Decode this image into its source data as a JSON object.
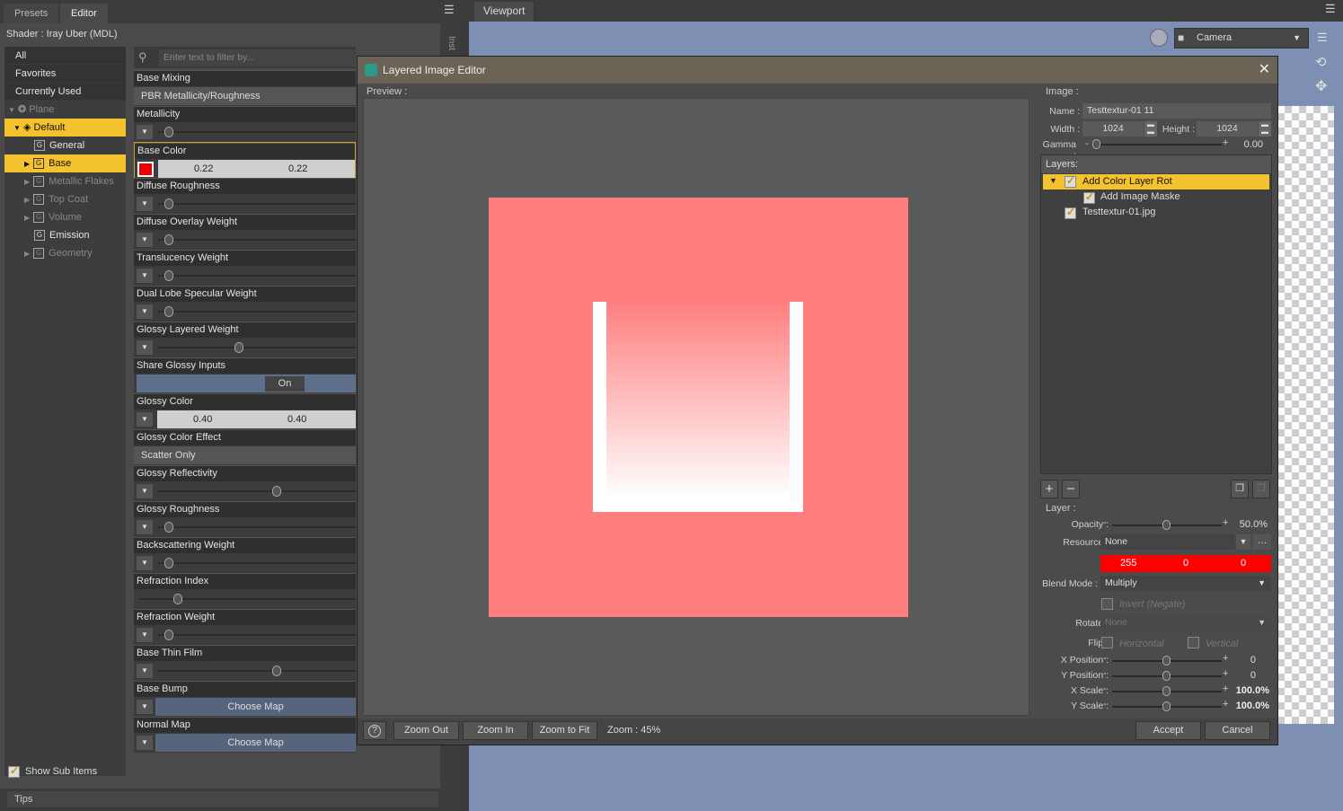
{
  "left_tabs": [
    "Presets",
    "Editor"
  ],
  "shader_label": "Shader :  Iray Uber (MDL)",
  "categories": [
    "All",
    "Favorites",
    "Currently Used"
  ],
  "tree": [
    {
      "label": "Plane"
    },
    {
      "label": "Default"
    },
    {
      "label": "General"
    },
    {
      "label": "Base"
    },
    {
      "label": "Metallic Flakes"
    },
    {
      "label": "Top Coat"
    },
    {
      "label": "Volume"
    },
    {
      "label": "Emission"
    },
    {
      "label": "Geometry"
    }
  ],
  "show_sub_items": "Show Sub Items",
  "filter_placeholder": "Enter text to filter by...",
  "properties": [
    {
      "label": "Base Mixing",
      "text": "PBR Metallicity/Roughness"
    },
    {
      "label": "Metallicity"
    },
    {
      "label": "Base Color",
      "v1": "0.22",
      "v2": "0.22"
    },
    {
      "label": "Diffuse Roughness"
    },
    {
      "label": "Diffuse Overlay Weight"
    },
    {
      "label": "Translucency Weight"
    },
    {
      "label": "Dual Lobe Specular Weight"
    },
    {
      "label": "Glossy Layered Weight"
    },
    {
      "label": "Share Glossy Inputs",
      "text": "On"
    },
    {
      "label": "Glossy Color",
      "v1": "0.40",
      "v2": "0.40"
    },
    {
      "label": "Glossy Color Effect",
      "text": "Scatter Only"
    },
    {
      "label": "Glossy Reflectivity"
    },
    {
      "label": "Glossy Roughness"
    },
    {
      "label": "Backscattering Weight"
    },
    {
      "label": "Refraction Index"
    },
    {
      "label": "Refraction Weight"
    },
    {
      "label": "Base Thin Film"
    },
    {
      "label": "Base Bump",
      "text": "Choose Map"
    },
    {
      "label": "Normal Map",
      "text": "Choose Map"
    }
  ],
  "tips": "Tips",
  "side_tab": "Inst",
  "viewport_tab": "Viewport",
  "camera": "Camera",
  "dialog": {
    "title": "Layered Image Editor",
    "preview_label": "Preview :",
    "image_label": "Image :",
    "name_label": "Name :",
    "name_value": "Testtextur-01 11",
    "width_label": "Width :",
    "width_value": "1024",
    "height_label": "Height :",
    "height_value": "1024",
    "gamma_label": "Gamma :",
    "gamma_value": "0.00",
    "layers_label": "Layers:",
    "layers": [
      "Add Color Layer Rot",
      "Add Image Maske",
      "Testtextur-01.jpg"
    ],
    "layer_label": "Layer :",
    "opacity_label": "Opacity :",
    "opacity_value": "50.0%",
    "resource_label": "Resource :",
    "resource_value": "None",
    "color": [
      "255",
      "0",
      "0"
    ],
    "blend_label": "Blend Mode :",
    "blend_value": "Multiply",
    "invert_label": "Invert (Negate)",
    "rotate_label": "Rotate :",
    "rotate_value": "None",
    "flip_label": "Flip :",
    "flip_h": "Horizontal",
    "flip_v": "Vertical",
    "xpos_label": "X Position :",
    "xpos_value": "0",
    "ypos_label": "Y Position :",
    "ypos_value": "0",
    "xscale_label": "X Scale :",
    "xscale_value": "100.0%",
    "yscale_label": "Y Scale :",
    "yscale_value": "100.0%",
    "zoom_out": "Zoom Out",
    "zoom_in": "Zoom In",
    "zoom_fit": "Zoom to Fit",
    "zoom_label": "Zoom : 45%",
    "accept": "Accept",
    "cancel": "Cancel"
  },
  "colors": {
    "selection": "#f4c22c",
    "preview_bg": "#ff7f7f",
    "dialog_title": "#6b6456",
    "viewport_bg": "#7d8fb3"
  }
}
